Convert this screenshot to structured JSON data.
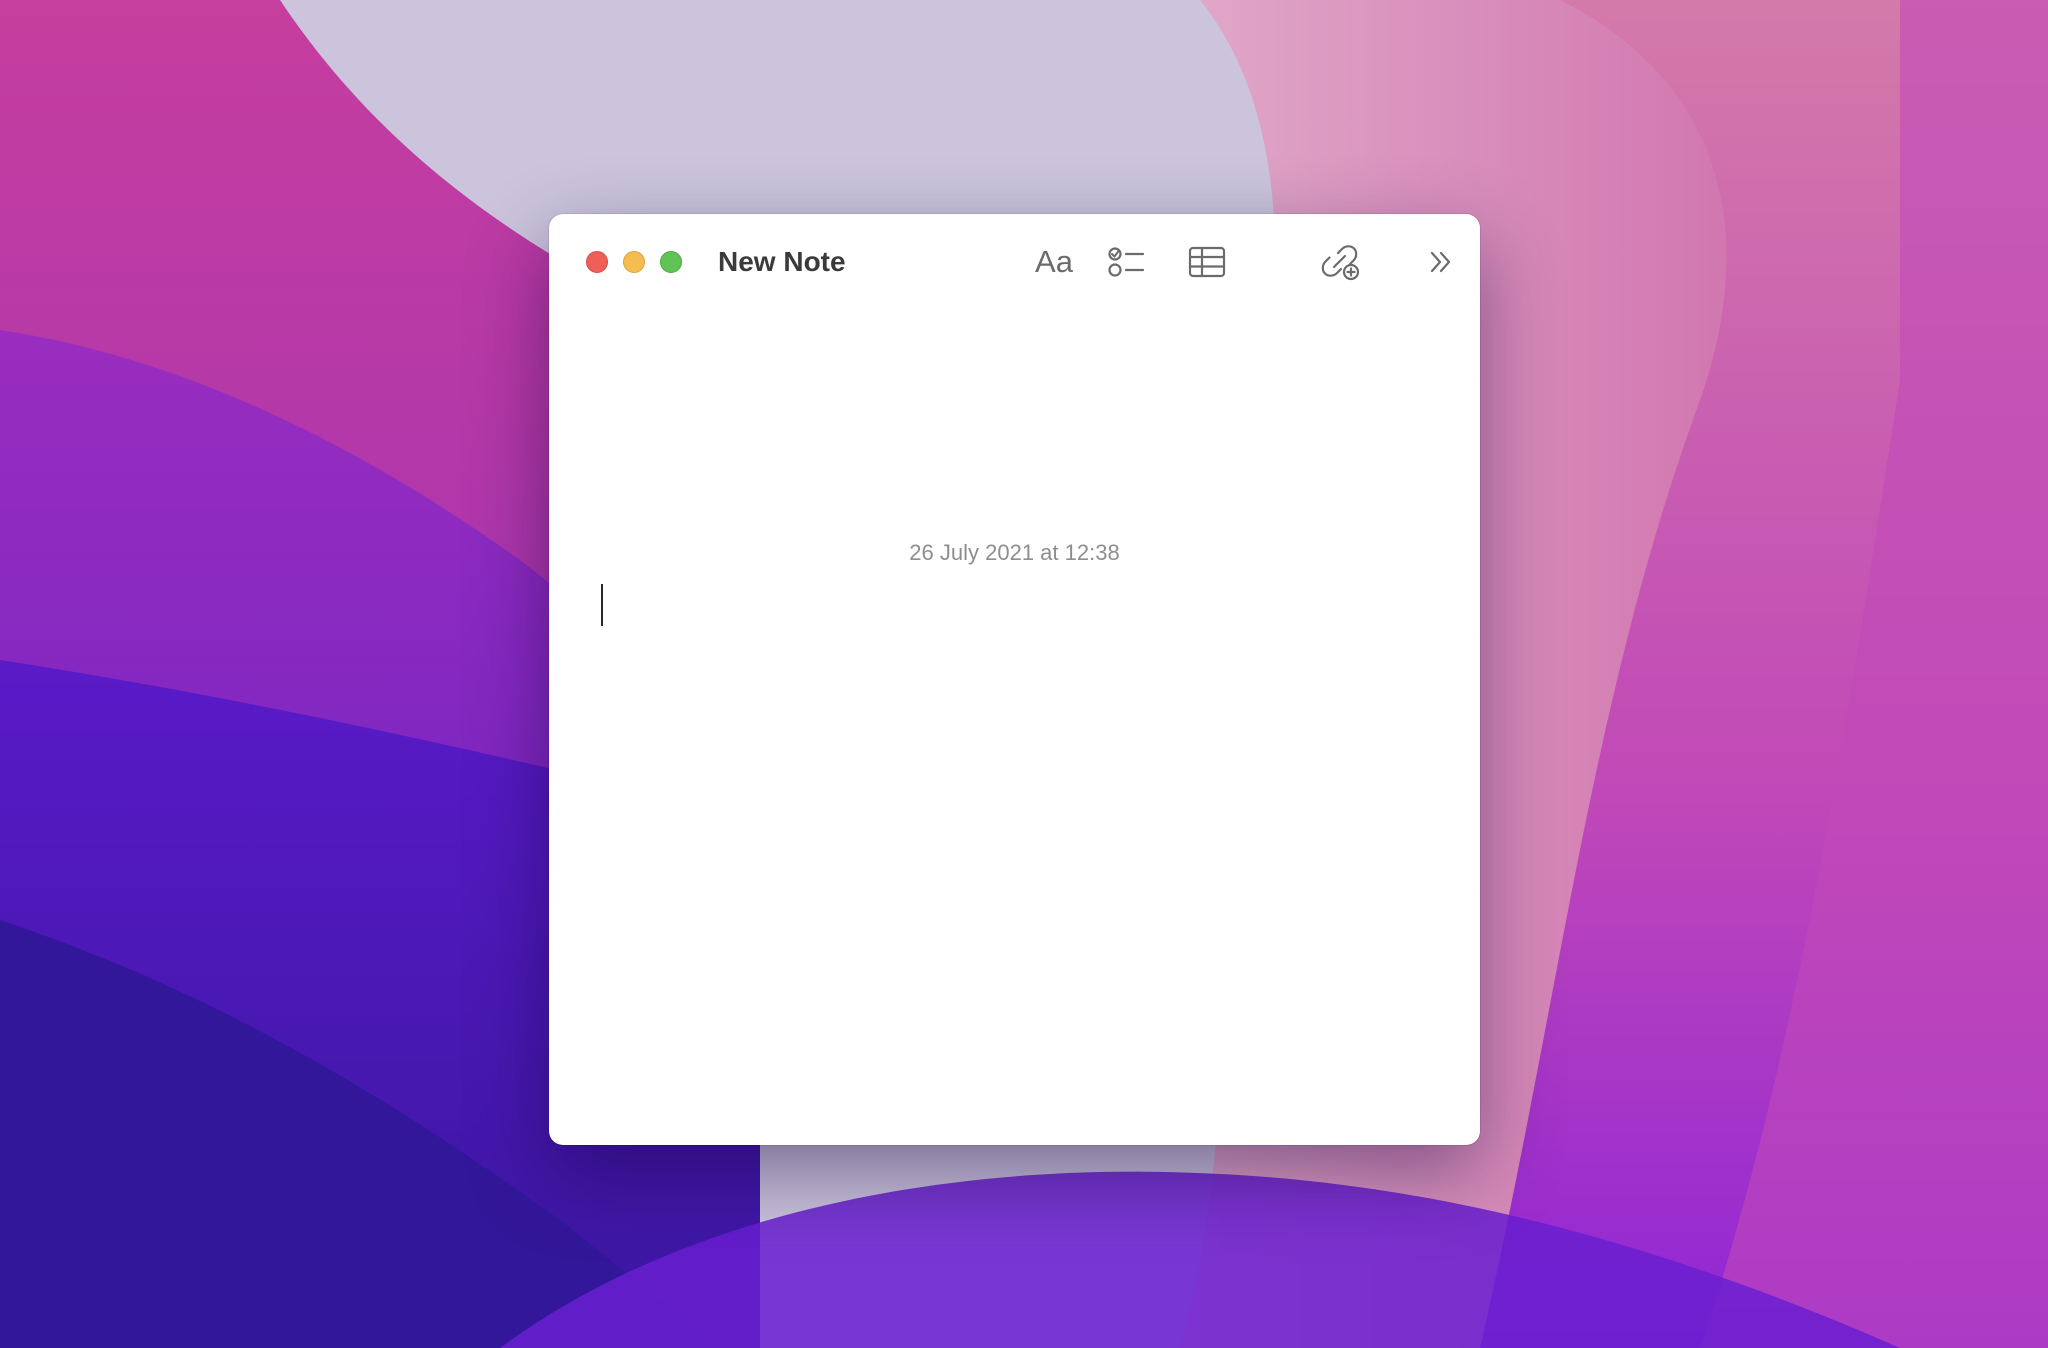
{
  "desktop": {
    "wallpaper": "purple-pink-gradient-wallpaper"
  },
  "window": {
    "title": "New Note",
    "controls": {
      "close_color": "#ee5f57",
      "minimize_color": "#f4bd4f",
      "zoom_color": "#5fc454"
    },
    "toolbar": {
      "format_label": "Aa",
      "format_icon": "text-format-icon",
      "checklist_icon": "checklist-icon",
      "table_icon": "table-icon",
      "collaborate_icon": "link-add-icon",
      "more_icon": "chevron-double-right-icon"
    }
  },
  "note": {
    "timestamp": "26 July 2021 at 12:38",
    "body": ""
  }
}
